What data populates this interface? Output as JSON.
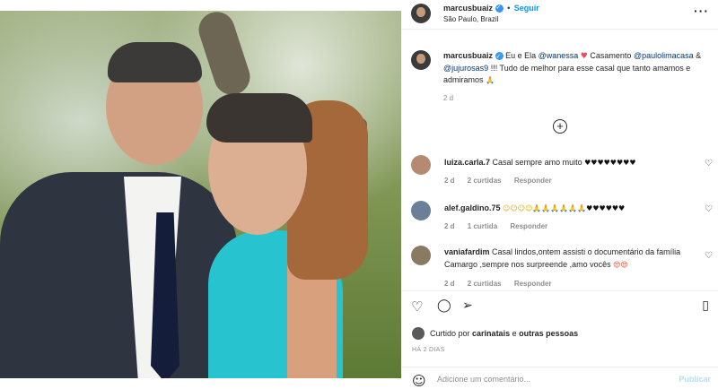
{
  "post": {
    "username": "marcusbuaiz",
    "follow_label": "Seguir",
    "location": "São Paulo, Brazil",
    "more_icon": "more-options-icon"
  },
  "caption": {
    "username": "marcusbuaiz",
    "text_1": "Eu e Ela",
    "mention_1": "@wanessa",
    "text_2": "Casamento",
    "mention_2": "@paulolimacasa",
    "text_3": "&",
    "mention_3": "@jujurosas9",
    "text_4": "!!! Tudo de melhor para esse casal que tanto amamos e admiramos",
    "time": "2 d"
  },
  "comments": [
    {
      "username": "luiza.carla.7",
      "text": "Casal sempre amo muito",
      "emoji": "♥♥♥♥♥♥♥♥",
      "time": "2 d",
      "likes": "2 curtidas",
      "reply": "Responder"
    },
    {
      "username": "alef.galdino.75",
      "text": "",
      "emoji": "☺☺☺☺🙏🙏🙏🙏🙏🙏",
      "emoji_hearts": "♥♥♥♥♥♥",
      "time": "2 d",
      "likes": "1 curtida",
      "reply": "Responder"
    },
    {
      "username": "vaniafardim",
      "text": "Casal lindos,ontem assisti o documentário da família Camargo ,sempre nos surpreende ,amo vocês",
      "emoji": "😍😍",
      "time": "2 d",
      "likes": "2 curtidas",
      "reply": "Responder"
    }
  ],
  "actions": {
    "liked_prefix": "Curtido por",
    "liked_user": "carinatais",
    "liked_and": "e",
    "liked_others": "outras pessoas",
    "ago": "HÁ 2 DIAS"
  },
  "add_comment": {
    "placeholder": "Adicione um comentário...",
    "publish_label": "Publicar"
  },
  "colors": {
    "link_blue": "#0095f6",
    "mention": "#00376b",
    "muted": "#8e8e8e"
  }
}
